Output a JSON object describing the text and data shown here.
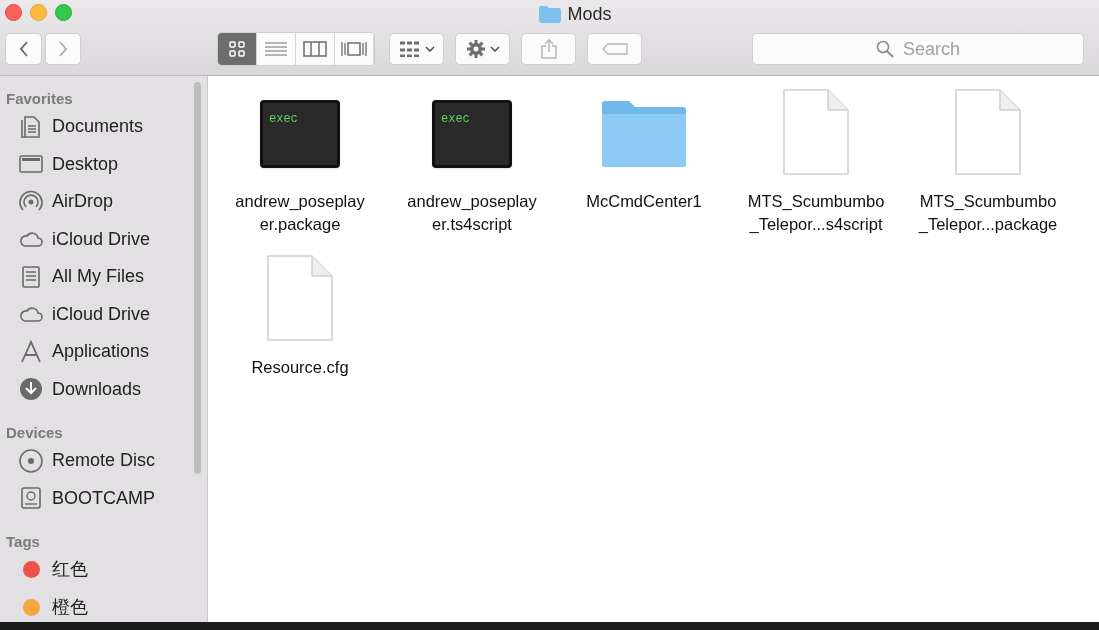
{
  "window": {
    "title": "Mods"
  },
  "toolbar": {
    "view_modes": [
      {
        "kind": "icons",
        "selected": true
      },
      {
        "kind": "list",
        "selected": false
      },
      {
        "kind": "columns",
        "selected": false
      },
      {
        "kind": "coverflow",
        "selected": false
      }
    ],
    "search": {
      "placeholder": "Search"
    }
  },
  "sidebar": {
    "sections": [
      {
        "title": "Favorites",
        "items": [
          {
            "kind": "documents",
            "label": "Documents"
          },
          {
            "kind": "desktop",
            "label": "Desktop"
          },
          {
            "kind": "airdrop",
            "label": "AirDrop"
          },
          {
            "kind": "cloud",
            "label": "iCloud Drive"
          },
          {
            "kind": "allfiles",
            "label": "All My Files"
          },
          {
            "kind": "cloud",
            "label": "iCloud Drive"
          },
          {
            "kind": "apps",
            "label": "Applications"
          },
          {
            "kind": "downloads",
            "label": "Downloads"
          }
        ]
      },
      {
        "title": "Devices",
        "items": [
          {
            "kind": "disc",
            "label": "Remote Disc"
          },
          {
            "kind": "drive",
            "label": "BOOTCAMP"
          }
        ]
      },
      {
        "title": "Tags",
        "items": [
          {
            "kind": "tag",
            "label": "红色",
            "color": "#f0524a"
          },
          {
            "kind": "tag",
            "label": "橙色",
            "color": "#f5a640"
          }
        ]
      }
    ]
  },
  "files": [
    {
      "kind": "exec",
      "icon_text": "exec",
      "name_lines": [
        "andrew_poseplay",
        "er.package"
      ]
    },
    {
      "kind": "exec",
      "icon_text": "exec",
      "name_lines": [
        "andrew_poseplay",
        "er.ts4script"
      ]
    },
    {
      "kind": "folder",
      "name_lines": [
        "McCmdCenter1"
      ]
    },
    {
      "kind": "document",
      "name_lines": [
        "MTS_Scumbumbo",
        "_Telepor...s4script"
      ]
    },
    {
      "kind": "document",
      "name_lines": [
        "MTS_Scumbumbo",
        "_Telepor...package"
      ]
    },
    {
      "kind": "document",
      "name_lines": [
        "Resource.cfg"
      ]
    }
  ]
}
